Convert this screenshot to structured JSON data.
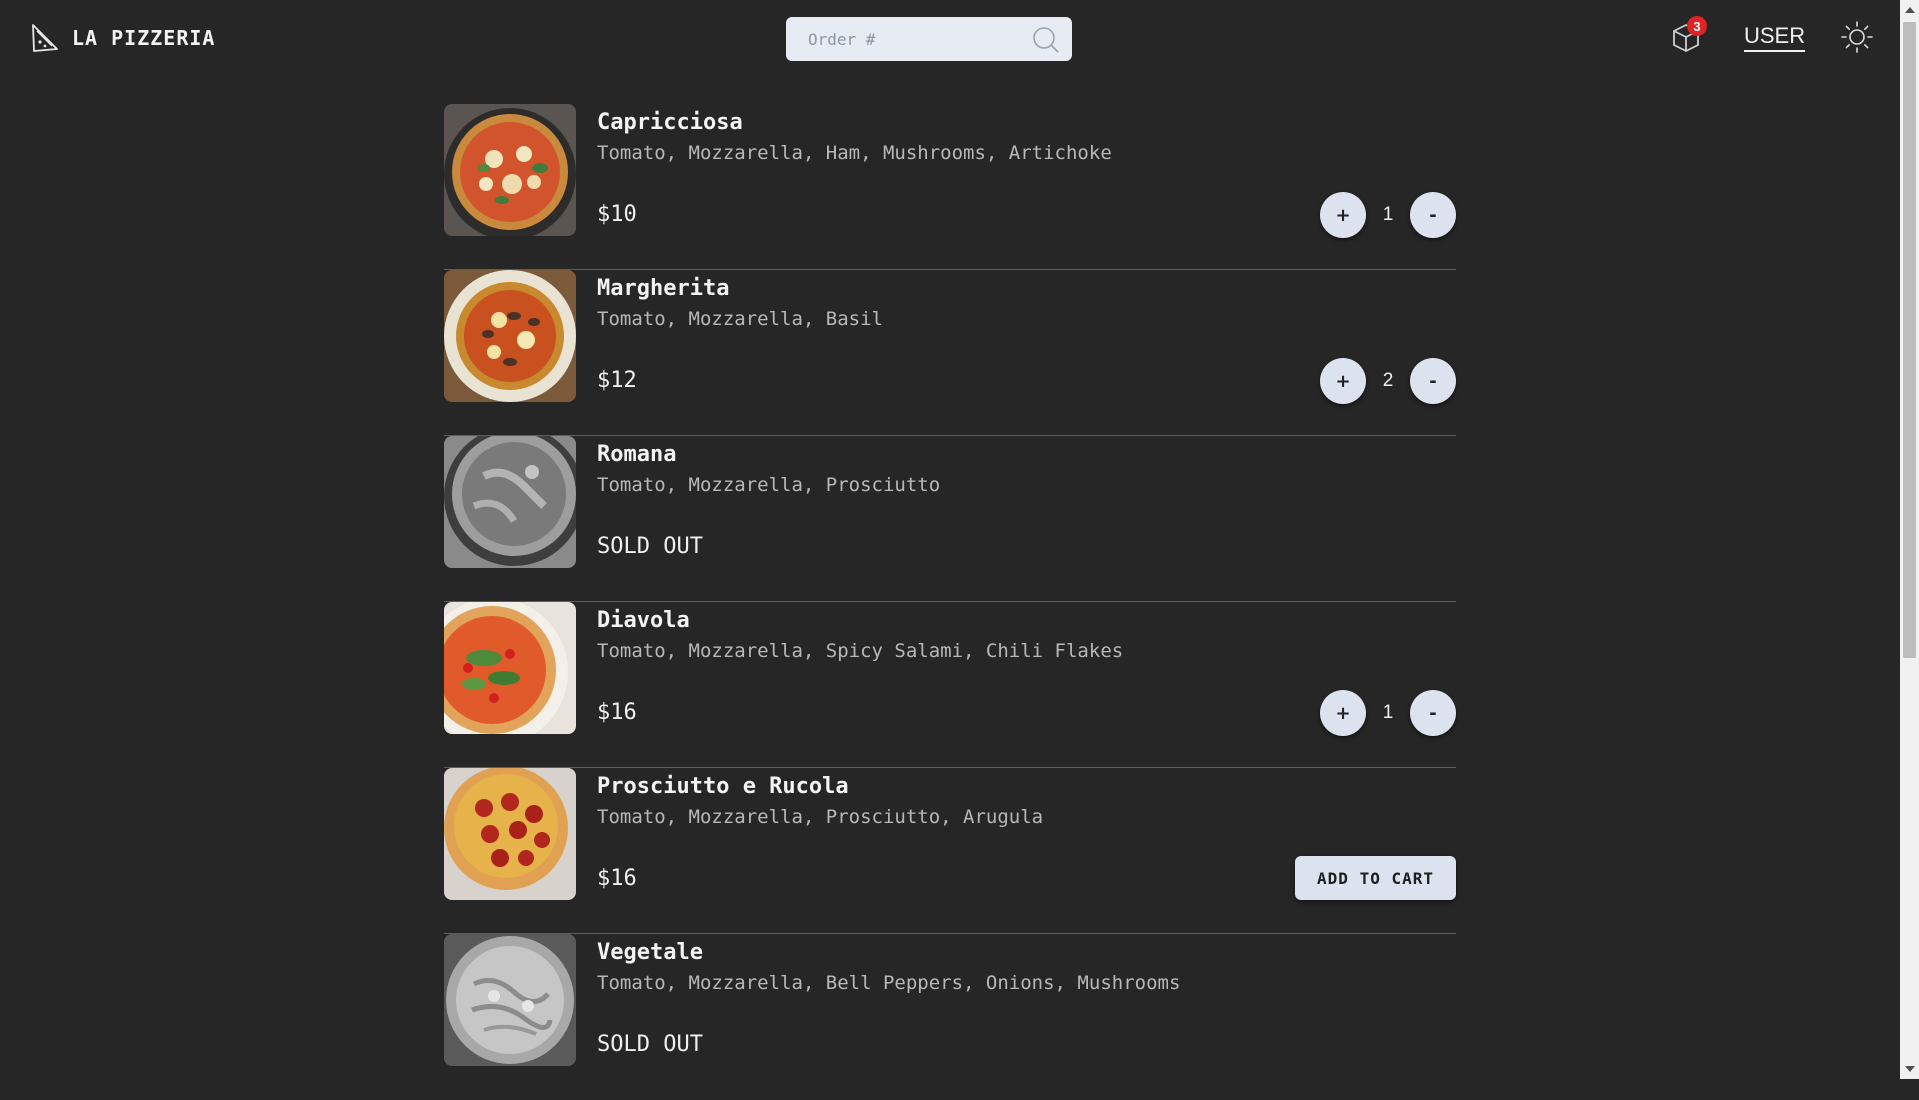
{
  "header": {
    "brand": "LA PIZZERIA",
    "search_placeholder": "Order #",
    "cart_count": "3",
    "user_label": "USER"
  },
  "menu": {
    "items": [
      {
        "name": "Capricciosa",
        "ingredients": "Tomato, Mozzarella, Ham, Mushrooms, Artichoke",
        "price": "$10",
        "quantity": "1"
      },
      {
        "name": "Margherita",
        "ingredients": "Tomato, Mozzarella, Basil",
        "price": "$12",
        "quantity": "2"
      },
      {
        "name": "Romana",
        "ingredients": "Tomato, Mozzarella, Prosciutto",
        "status": "SOLD OUT"
      },
      {
        "name": "Diavola",
        "ingredients": "Tomato, Mozzarella, Spicy Salami, Chili Flakes",
        "price": "$16",
        "quantity": "1"
      },
      {
        "name": "Prosciutto e Rucola",
        "ingredients": "Tomato, Mozzarella, Prosciutto, Arugula",
        "price": "$16",
        "add_label": "ADD TO CART"
      },
      {
        "name": "Vegetale",
        "ingredients": "Tomato, Mozzarella, Bell Peppers, Onions, Mushrooms",
        "status": "SOLD OUT"
      }
    ],
    "plus_label": "+",
    "minus_label": "-"
  },
  "colors": {
    "background": "#262626",
    "button": "#dde3ee",
    "badge": "#e02424"
  }
}
